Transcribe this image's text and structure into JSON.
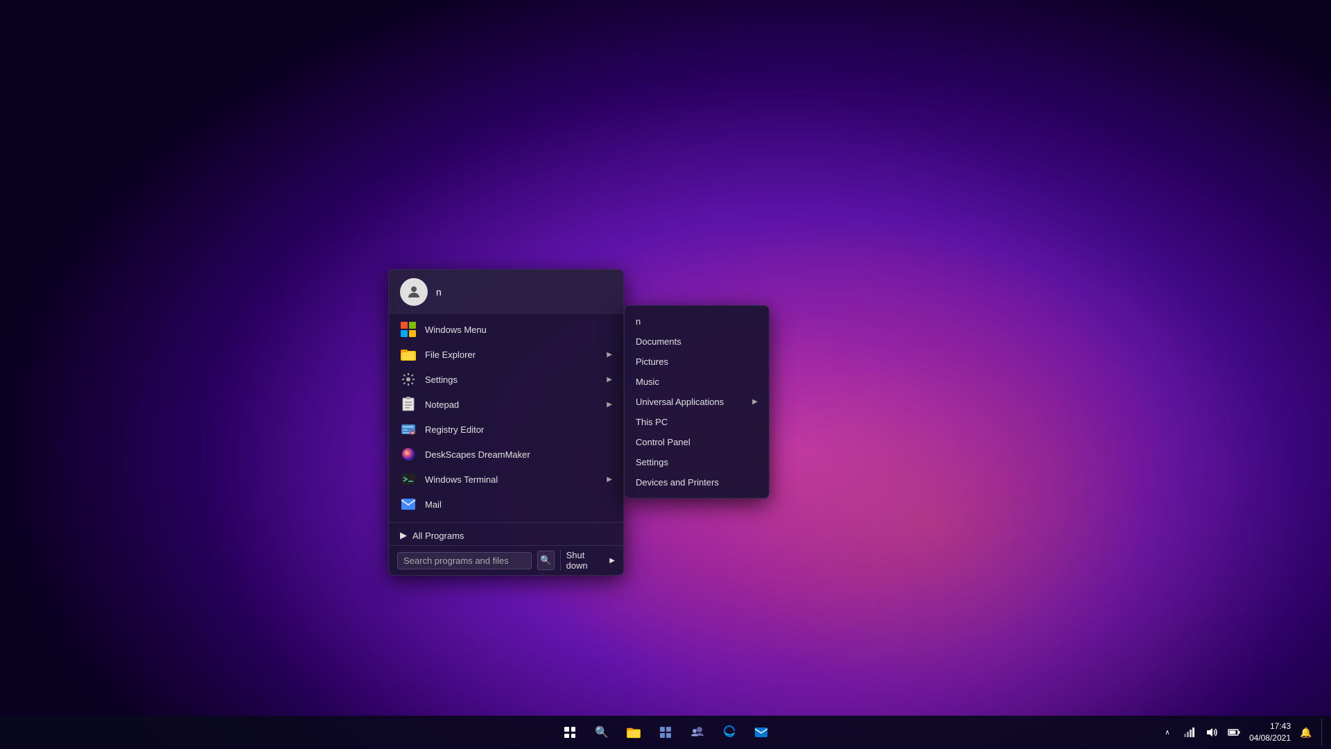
{
  "wallpaper": {
    "description": "Dark purple gradient desktop wallpaper"
  },
  "startMenu": {
    "user": {
      "name": "n",
      "avatarIcon": "person-icon"
    },
    "menuItems": [
      {
        "id": "windows-menu",
        "label": "Windows Menu",
        "icon": "windows-menu-icon",
        "hasArrow": false
      },
      {
        "id": "file-explorer",
        "label": "File Explorer",
        "icon": "folder-icon",
        "hasArrow": true
      },
      {
        "id": "settings",
        "label": "Settings",
        "icon": "settings-icon",
        "hasArrow": true
      },
      {
        "id": "notepad",
        "label": "Notepad",
        "icon": "notepad-icon",
        "hasArrow": true
      },
      {
        "id": "registry-editor",
        "label": "Registry Editor",
        "icon": "registry-icon",
        "hasArrow": false
      },
      {
        "id": "deskscapes",
        "label": "DeskScapes DreamMaker",
        "icon": "deskscapes-icon",
        "hasArrow": false
      },
      {
        "id": "windows-terminal",
        "label": "Windows Terminal",
        "icon": "terminal-icon",
        "hasArrow": true
      },
      {
        "id": "mail",
        "label": "Mail",
        "icon": "mail-icon",
        "hasArrow": false
      }
    ],
    "allPrograms": "All Programs",
    "search": {
      "placeholder": "Search programs and files",
      "value": ""
    },
    "shutdown": {
      "label": "Shut down",
      "hasArrow": true
    }
  },
  "rightPanel": {
    "user": "n",
    "items": [
      {
        "id": "documents",
        "label": "Documents",
        "hasArrow": false
      },
      {
        "id": "pictures",
        "label": "Pictures",
        "hasArrow": false
      },
      {
        "id": "music",
        "label": "Music",
        "hasArrow": false
      },
      {
        "id": "universal-apps",
        "label": "Universal Applications",
        "hasArrow": true
      },
      {
        "id": "this-pc",
        "label": "This PC",
        "hasArrow": false
      },
      {
        "id": "control-panel",
        "label": "Control Panel",
        "hasArrow": false
      },
      {
        "id": "settings-right",
        "label": "Settings",
        "hasArrow": false
      },
      {
        "id": "devices-printers",
        "label": "Devices and Printers",
        "hasArrow": false
      }
    ]
  },
  "taskbar": {
    "startButton": "⊞",
    "searchIcon": "🔍",
    "items": [
      {
        "id": "file-explorer",
        "icon": "folder-taskbar-icon"
      },
      {
        "id": "task-view",
        "icon": "taskview-icon"
      },
      {
        "id": "teams",
        "icon": "teams-icon"
      },
      {
        "id": "edge",
        "icon": "edge-icon"
      },
      {
        "id": "mail",
        "icon": "mail-taskbar-icon"
      }
    ],
    "tray": {
      "time": "17:43",
      "date": "04/08/2021",
      "icons": [
        "chevron-up-icon",
        "network-icon",
        "volume-icon",
        "battery-icon"
      ]
    }
  }
}
